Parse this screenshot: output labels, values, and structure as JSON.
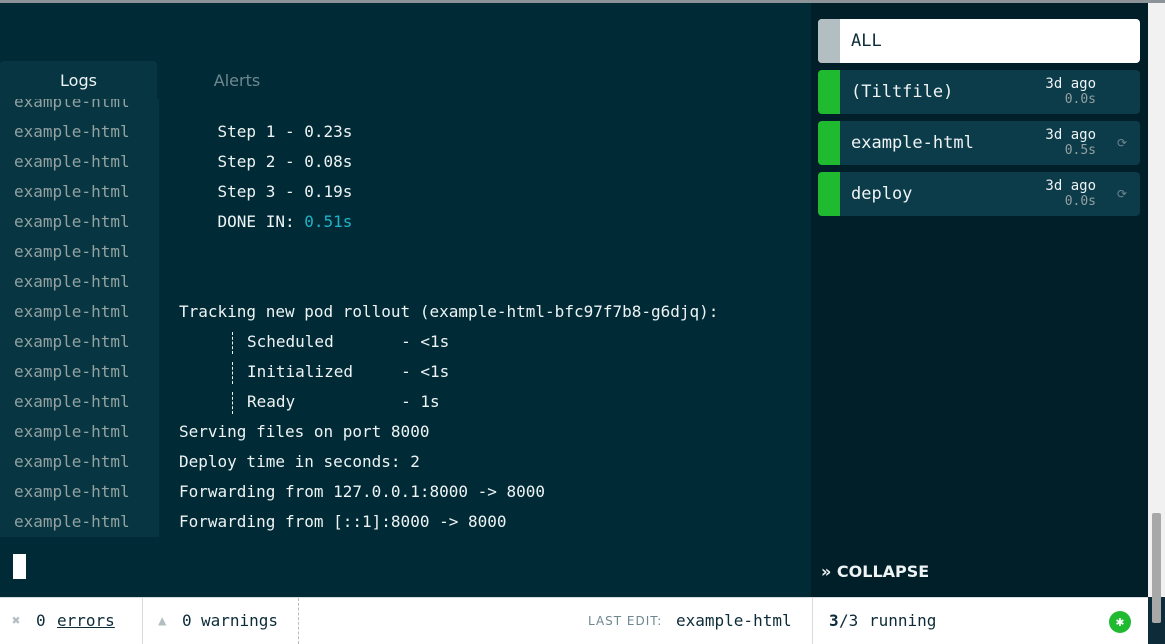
{
  "tabs": {
    "logs": "Logs",
    "alerts": "Alerts"
  },
  "log_lines": [
    {
      "source": "example-html",
      "text": ""
    },
    {
      "source": "example-html",
      "text": "    Step 1 - 0.23s"
    },
    {
      "source": "example-html",
      "text": "    Step 2 - 0.08s"
    },
    {
      "source": "example-html",
      "text": "    Step 3 - 0.19s"
    },
    {
      "source": "example-html",
      "text": "    DONE IN: ",
      "highlight": "0.51s"
    },
    {
      "source": "example-html",
      "text": ""
    },
    {
      "source": "example-html",
      "text": ""
    },
    {
      "source": "example-html",
      "text": "Tracking new pod rollout (example-html-bfc97f7b8-g6djq):"
    },
    {
      "source": "example-html",
      "text": "Scheduled       - <1s",
      "tree": true
    },
    {
      "source": "example-html",
      "text": "Initialized     - <1s",
      "tree": true
    },
    {
      "source": "example-html",
      "text": "Ready           - 1s",
      "tree": true
    },
    {
      "source": "example-html",
      "text": "Serving files on port 8000"
    },
    {
      "source": "example-html",
      "text": "Deploy time in seconds: 2"
    },
    {
      "source": "example-html",
      "text": "Forwarding from 127.0.0.1:8000 -> 8000"
    },
    {
      "source": "example-html",
      "text": "Forwarding from [::1]:8000 -> 8000"
    }
  ],
  "sidebar": {
    "all_label": "ALL",
    "resources": [
      {
        "name": "(Tiltfile)",
        "ago": "3d ago",
        "duration": "0.0s",
        "spinner": false
      },
      {
        "name": "example-html",
        "ago": "3d ago",
        "duration": "0.5s",
        "spinner": true
      },
      {
        "name": "deploy",
        "ago": "3d ago",
        "duration": "0.0s",
        "spinner": true
      }
    ],
    "collapse_label": "COLLAPSE",
    "status_color": "#20ba31"
  },
  "footer": {
    "errors_count": "0",
    "errors_label": "errors",
    "warnings_count": "0",
    "warnings_label": "warnings",
    "last_edit_label": "LAST EDIT:",
    "last_edit_value": "example-html",
    "running_count": "3",
    "running_total": "/3",
    "running_label": "running"
  }
}
